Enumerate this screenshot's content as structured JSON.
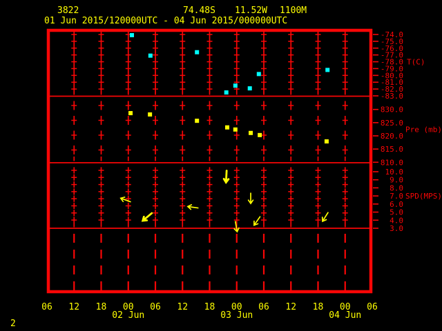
{
  "header": {
    "station_id": "3822",
    "latitude": "74.48S",
    "longitude": "11.52W",
    "elevation": "1100M",
    "time_range": "01 Jun 2015/120000UTC - 04 Jun 2015/000000UTC"
  },
  "page_number": "2",
  "colors": {
    "background": "#000000",
    "frame": "#f90606",
    "axis": "#f90606",
    "label_yellow": "#ffff00",
    "temperature_point": "#00ffff",
    "pressure_point": "#ffff00",
    "wind_arrow": "#ffff00"
  },
  "x_axis": {
    "hours_span": 72,
    "tick_interval_hours": 6,
    "tick_labels": [
      "06",
      "12",
      "18",
      "00",
      "06",
      "12",
      "18",
      "00",
      "06",
      "12",
      "18",
      "00",
      "06"
    ],
    "date_labels": [
      {
        "text": "02 Jun",
        "at_hour": 18
      },
      {
        "text": "03 Jun",
        "at_hour": 42
      },
      {
        "text": "04 Jun",
        "at_hour": 66
      }
    ]
  },
  "y_axes": [
    {
      "id": "temperature",
      "name": "T(C)",
      "name_v": -78,
      "tick_labels": [
        "-74.0",
        "-75.0",
        "-76.0",
        "-77.0",
        "-78.0",
        "-79.0",
        "-80.0",
        "-81.0",
        "-82.0",
        "-83.0"
      ]
    },
    {
      "id": "pressure",
      "name": "Pre (mb)",
      "name_v": 822.5,
      "tick_labels": [
        "830.0",
        "825.0",
        "820.0",
        "815.0",
        "810.0"
      ]
    },
    {
      "id": "speed",
      "name": "SPD(MPS)",
      "name_v": 7,
      "tick_labels": [
        "10.0",
        "9.0",
        "8.0",
        "7.0",
        "6.0",
        "5.0",
        "4.0",
        "3.0"
      ]
    }
  ],
  "chart_data": [
    {
      "type": "scatter",
      "series_name": "Temperature",
      "axis": "temperature",
      "marker": "square",
      "color_key": "temperature_point",
      "unit": "C",
      "x_unit": "hours since 01 Jun 2015 06:00 UTC",
      "ylim": [
        -83,
        -74
      ],
      "points": [
        {
          "t": 18.8,
          "v": -74.1
        },
        {
          "t": 22.9,
          "v": -77.1
        },
        {
          "t": 33.2,
          "v": -76.6
        },
        {
          "t": 39.7,
          "v": -82.5
        },
        {
          "t": 41.7,
          "v": -81.5
        },
        {
          "t": 44.9,
          "v": -81.9
        },
        {
          "t": 46.9,
          "v": -79.8
        },
        {
          "t": 62.1,
          "v": -79.2
        }
      ]
    },
    {
      "type": "scatter",
      "series_name": "Pressure",
      "axis": "pressure",
      "marker": "square",
      "color_key": "pressure_point",
      "unit": "mb",
      "x_unit": "hours since 01 Jun 2015 06:00 UTC",
      "ylim": [
        810,
        830
      ],
      "points": [
        {
          "t": 18.5,
          "v": 828.6
        },
        {
          "t": 22.8,
          "v": 828.1
        },
        {
          "t": 33.2,
          "v": 825.7
        },
        {
          "t": 39.9,
          "v": 823.2
        },
        {
          "t": 41.7,
          "v": 822.4
        },
        {
          "t": 45.1,
          "v": 821.1
        },
        {
          "t": 47.1,
          "v": 820.3
        },
        {
          "t": 61.9,
          "v": 817.9
        }
      ]
    },
    {
      "type": "scatter",
      "series_name": "Wind Speed",
      "axis": "speed",
      "marker": "arrow",
      "color_key": "wind_arrow",
      "unit": "MPS",
      "x_unit": "hours since 01 Jun 2015 06:00 UTC",
      "ylim": [
        3,
        10
      ],
      "points": [
        {
          "t": 17.4,
          "v": 6.5,
          "arrow_angle_deg": 200
        },
        {
          "t": 22.2,
          "v": 4.4,
          "arrow_angle_deg": 140,
          "bold": true
        },
        {
          "t": 32.3,
          "v": 5.6,
          "arrow_angle_deg": 188
        },
        {
          "t": 39.7,
          "v": 9.4,
          "arrow_angle_deg": 93,
          "bold": true
        },
        {
          "t": 45.1,
          "v": 6.7,
          "arrow_angle_deg": 90
        },
        {
          "t": 41.9,
          "v": 3.2,
          "arrow_angle_deg": 80
        },
        {
          "t": 46.5,
          "v": 3.9,
          "arrow_angle_deg": 125
        },
        {
          "t": 61.6,
          "v": 4.4,
          "arrow_angle_deg": 122
        }
      ]
    }
  ]
}
